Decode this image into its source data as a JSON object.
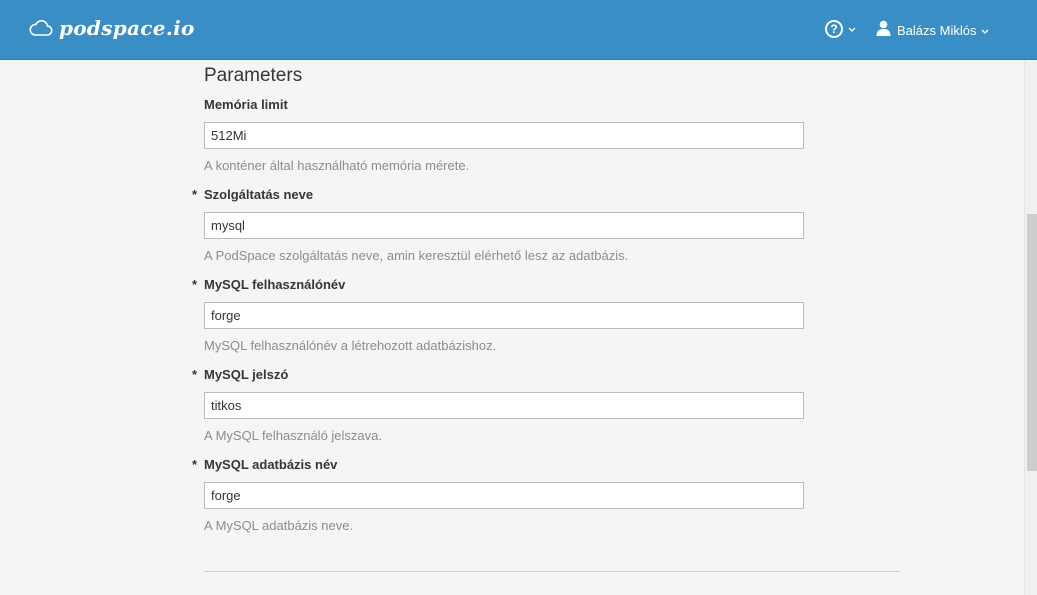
{
  "header": {
    "brand": "podspace.io",
    "brand_icon": "cloud-icon",
    "help_icon": "question-circle-icon",
    "user_icon": "user-icon",
    "user_name": "Balázs Miklós"
  },
  "colors": {
    "navbar": "#3a8ec6",
    "background": "#f5f5f5",
    "help_text": "#8b8d8f"
  },
  "section": {
    "title": "Parameters"
  },
  "fields": [
    {
      "label": "Memória limit",
      "required": false,
      "required_marker": "",
      "value": "512Mi",
      "help": "A konténer által használható memória mérete."
    },
    {
      "label": "Szolgáltatás neve",
      "required": true,
      "required_marker": "*",
      "value": "mysql",
      "help": "A PodSpace szolgáltatás neve, amin keresztül elérhető lesz az adatbázis."
    },
    {
      "label": "MySQL felhasználónév",
      "required": true,
      "required_marker": "*",
      "value": "forge",
      "help": "MySQL felhasználónév a létrehozott adatbázishoz."
    },
    {
      "label": "MySQL jelszó",
      "required": true,
      "required_marker": "*",
      "value": "titkos",
      "help": "A MySQL felhasználó jelszava."
    },
    {
      "label": "MySQL adatbázis név",
      "required": true,
      "required_marker": "*",
      "value": "forge",
      "help": "A MySQL adatbázis neve."
    }
  ]
}
